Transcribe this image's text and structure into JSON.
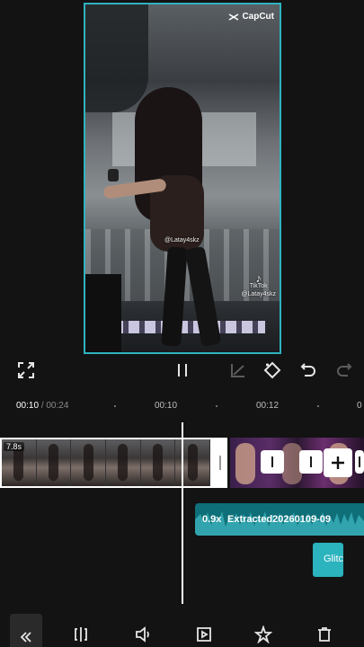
{
  "preview": {
    "brand": "CapCut",
    "watermark_handle": "@Latay4skz",
    "watermark_tiktok": "TikTok",
    "watermark_tiktok_handle": "@Latay4skz"
  },
  "controls": {
    "fullscreen_icon": "fullscreen-icon",
    "pause_icon": "pause-icon",
    "keyframe_icon": "keyframe-icon",
    "diamond_icon": "diamond-keyframe-icon",
    "undo_icon": "undo-icon",
    "redo_icon": "redo-icon"
  },
  "ruler": {
    "current_time": "00:10",
    "total_time": "/ 00:24",
    "marks": [
      "00:10",
      "00:12",
      "0"
    ]
  },
  "timeline": {
    "main_clip_duration": "7.8s",
    "audio_speed": "0.9x",
    "audio_name": "Extracted20260109-09",
    "effect_label": "Glitc"
  },
  "toolbar": {
    "items": [
      "back-icon",
      "split-icon",
      "volume-icon",
      "animation-icon",
      "effects-icon",
      "delete-icon"
    ]
  },
  "colors": {
    "accent": "#2fb3bf",
    "background": "#131313",
    "audio_track": "#0f6f78"
  }
}
